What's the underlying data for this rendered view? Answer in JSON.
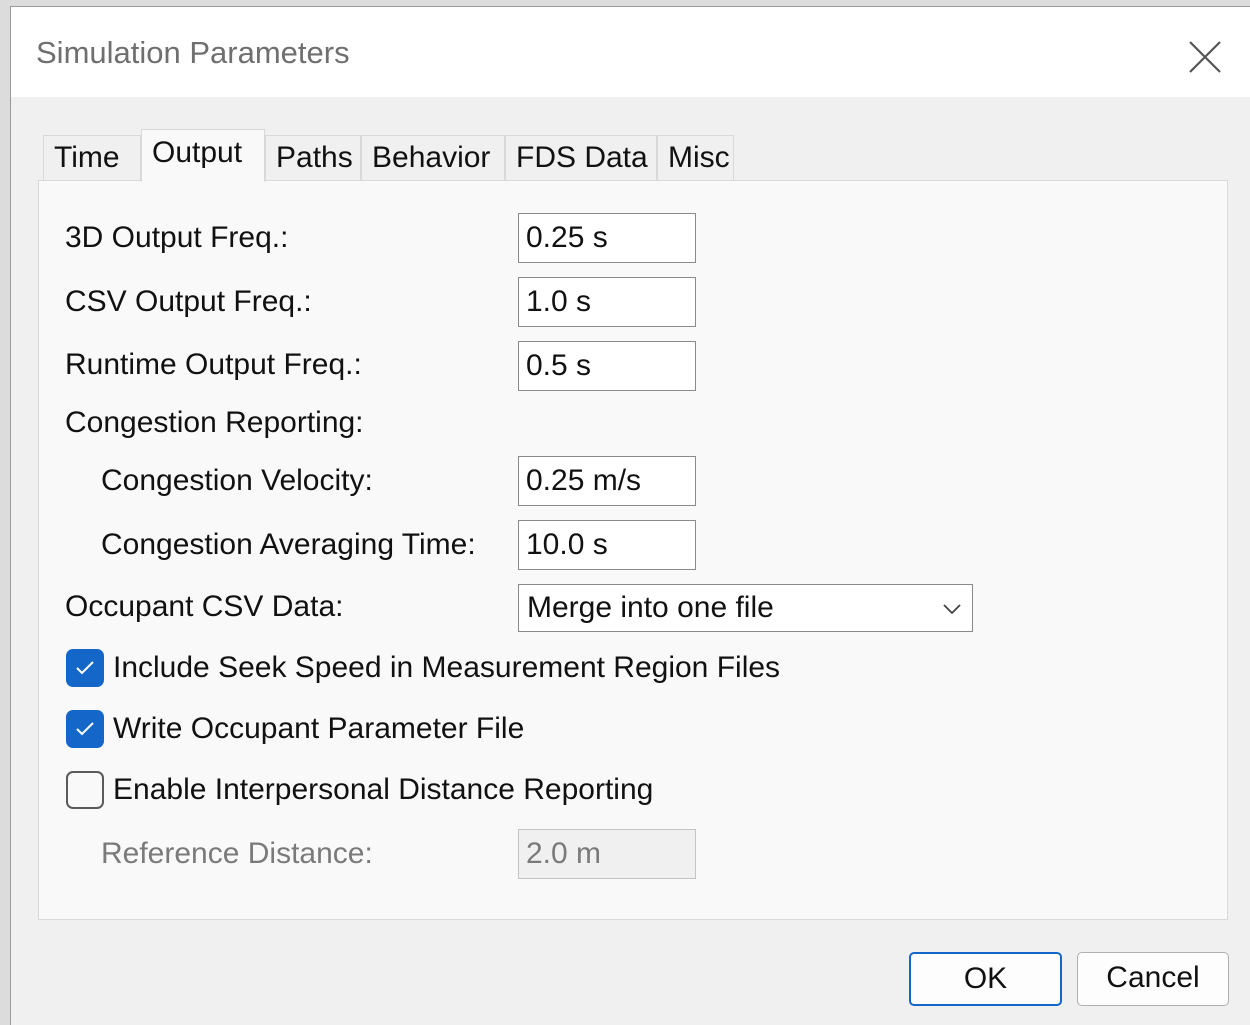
{
  "window": {
    "title": "Simulation Parameters",
    "close_icon": "close-icon"
  },
  "tabs": [
    {
      "label": "Time",
      "active": false
    },
    {
      "label": "Output",
      "active": true
    },
    {
      "label": "Paths",
      "active": false
    },
    {
      "label": "Behavior",
      "active": false
    },
    {
      "label": "FDS Data",
      "active": false
    },
    {
      "label": "Misc",
      "active": false
    }
  ],
  "output": {
    "freq_3d": {
      "label": "3D Output Freq.:",
      "value": "0.25 s"
    },
    "freq_csv": {
      "label": "CSV Output Freq.:",
      "value": "1.0 s"
    },
    "freq_runtime": {
      "label": "Runtime Output Freq.:",
      "value": "0.5 s"
    },
    "congestion_heading": "Congestion Reporting:",
    "congestion_velocity": {
      "label": "Congestion Velocity:",
      "value": "0.25 m/s"
    },
    "congestion_avg_time": {
      "label": "Congestion Averaging Time:",
      "value": "10.0 s"
    },
    "occupant_csv": {
      "label": "Occupant CSV Data:",
      "selected": "Merge into one file"
    },
    "seek_speed": {
      "label": "Include Seek Speed in Measurement Region Files",
      "checked": true
    },
    "occupant_param_file": {
      "label": "Write Occupant Parameter File",
      "checked": true
    },
    "interpersonal": {
      "label": "Enable Interpersonal Distance Reporting",
      "checked": false
    },
    "reference_distance": {
      "label": "Reference Distance:",
      "value": "2.0 m",
      "enabled": false
    }
  },
  "buttons": {
    "ok": "OK",
    "cancel": "Cancel"
  },
  "colors": {
    "accent": "#1467c8",
    "window_bg": "#f0f0f0",
    "panel_bg": "#f9f9f9"
  }
}
